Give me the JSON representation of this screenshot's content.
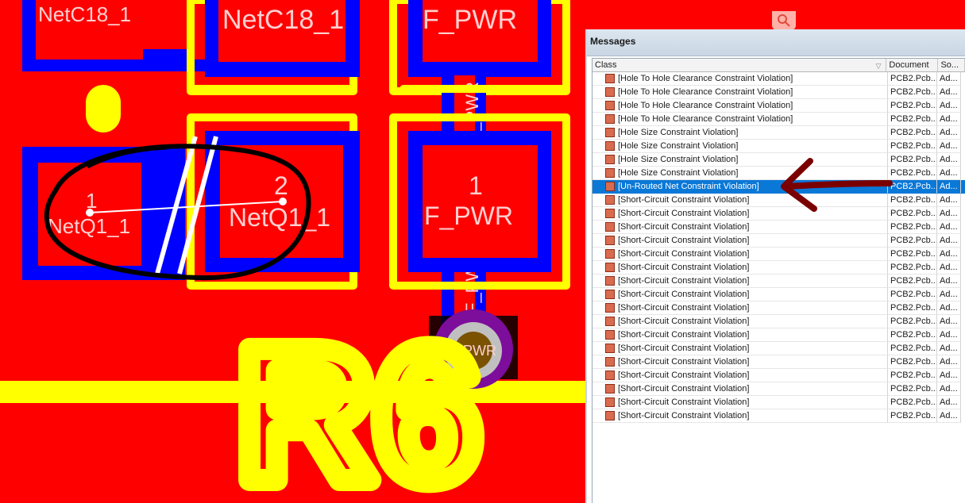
{
  "pcb": {
    "pad_labels": {
      "netc18_left": "NetC18_1",
      "netc18_right": "NetC18_1",
      "fpwr_top": "F_PWR",
      "q1_pad1_number": "1",
      "q1_pad1_net": "NetQ1_1",
      "q1_pad2_number": "2",
      "q1_pad2_net": "NetQ1_1",
      "fpwr_pad_number": "1",
      "fpwr_pad_net": "F_PWR",
      "trace_label_top": "F_PWR",
      "trace_label_bottom": "F_PW",
      "via_label": "F_PWR"
    },
    "silkscreen_designator": "R6",
    "colors": {
      "copper": "#ff0000",
      "solder_mask": "#0000ff",
      "silkscreen": "#ffff00",
      "via_ring": "#7d0d9b",
      "via_pad": "#c0c0c0",
      "via_hole": "#7a5200"
    }
  },
  "messages_panel": {
    "title": "Messages",
    "columns": [
      "Class",
      "Document",
      "So..."
    ],
    "rows": [
      {
        "class": "[Hole To Hole Clearance Constraint Violation]",
        "document": "PCB2.Pcb...",
        "source": "Ad..."
      },
      {
        "class": "[Hole To Hole Clearance Constraint Violation]",
        "document": "PCB2.Pcb...",
        "source": "Ad..."
      },
      {
        "class": "[Hole To Hole Clearance Constraint Violation]",
        "document": "PCB2.Pcb...",
        "source": "Ad..."
      },
      {
        "class": "[Hole To Hole Clearance Constraint Violation]",
        "document": "PCB2.Pcb...",
        "source": "Ad..."
      },
      {
        "class": "[Hole Size Constraint Violation]",
        "document": "PCB2.Pcb...",
        "source": "Ad..."
      },
      {
        "class": "[Hole Size Constraint Violation]",
        "document": "PCB2.Pcb...",
        "source": "Ad..."
      },
      {
        "class": "[Hole Size Constraint Violation]",
        "document": "PCB2.Pcb...",
        "source": "Ad..."
      },
      {
        "class": "[Hole Size Constraint Violation]",
        "document": "PCB2.Pcb...",
        "source": "Ad..."
      },
      {
        "class": "[Un-Routed Net Constraint Violation]",
        "document": "PCB2.Pcb...",
        "source": "Ad...",
        "selected": true
      },
      {
        "class": "[Short-Circuit Constraint Violation]",
        "document": "PCB2.Pcb...",
        "source": "Ad..."
      },
      {
        "class": "[Short-Circuit Constraint Violation]",
        "document": "PCB2.Pcb...",
        "source": "Ad..."
      },
      {
        "class": "[Short-Circuit Constraint Violation]",
        "document": "PCB2.Pcb...",
        "source": "Ad..."
      },
      {
        "class": "[Short-Circuit Constraint Violation]",
        "document": "PCB2.Pcb...",
        "source": "Ad..."
      },
      {
        "class": "[Short-Circuit Constraint Violation]",
        "document": "PCB2.Pcb...",
        "source": "Ad..."
      },
      {
        "class": "[Short-Circuit Constraint Violation]",
        "document": "PCB2.Pcb...",
        "source": "Ad..."
      },
      {
        "class": "[Short-Circuit Constraint Violation]",
        "document": "PCB2.Pcb...",
        "source": "Ad..."
      },
      {
        "class": "[Short-Circuit Constraint Violation]",
        "document": "PCB2.Pcb...",
        "source": "Ad..."
      },
      {
        "class": "[Short-Circuit Constraint Violation]",
        "document": "PCB2.Pcb...",
        "source": "Ad..."
      },
      {
        "class": "[Short-Circuit Constraint Violation]",
        "document": "PCB2.Pcb...",
        "source": "Ad..."
      },
      {
        "class": "[Short-Circuit Constraint Violation]",
        "document": "PCB2.Pcb...",
        "source": "Ad..."
      },
      {
        "class": "[Short-Circuit Constraint Violation]",
        "document": "PCB2.Pcb...",
        "source": "Ad..."
      },
      {
        "class": "[Short-Circuit Constraint Violation]",
        "document": "PCB2.Pcb...",
        "source": "Ad..."
      },
      {
        "class": "[Short-Circuit Constraint Violation]",
        "document": "PCB2.Pcb...",
        "source": "Ad..."
      },
      {
        "class": "[Short-Circuit Constraint Violation]",
        "document": "PCB2.Pcb...",
        "source": "Ad..."
      },
      {
        "class": "[Short-Circuit Constraint Violation]",
        "document": "PCB2.Pcb...",
        "source": "Ad..."
      },
      {
        "class": "[Short-Circuit Constraint Violation]",
        "document": "PCB2.Pcb...",
        "source": "Ad..."
      }
    ],
    "row_icon": "error-marker-icon",
    "sort_icon": "sort-filter-icon",
    "selected_color": "#0a78d7"
  },
  "annotations": {
    "circle_color": "#000000",
    "arrow_color": "#7a0000"
  },
  "search_icon": "magnifier-icon"
}
